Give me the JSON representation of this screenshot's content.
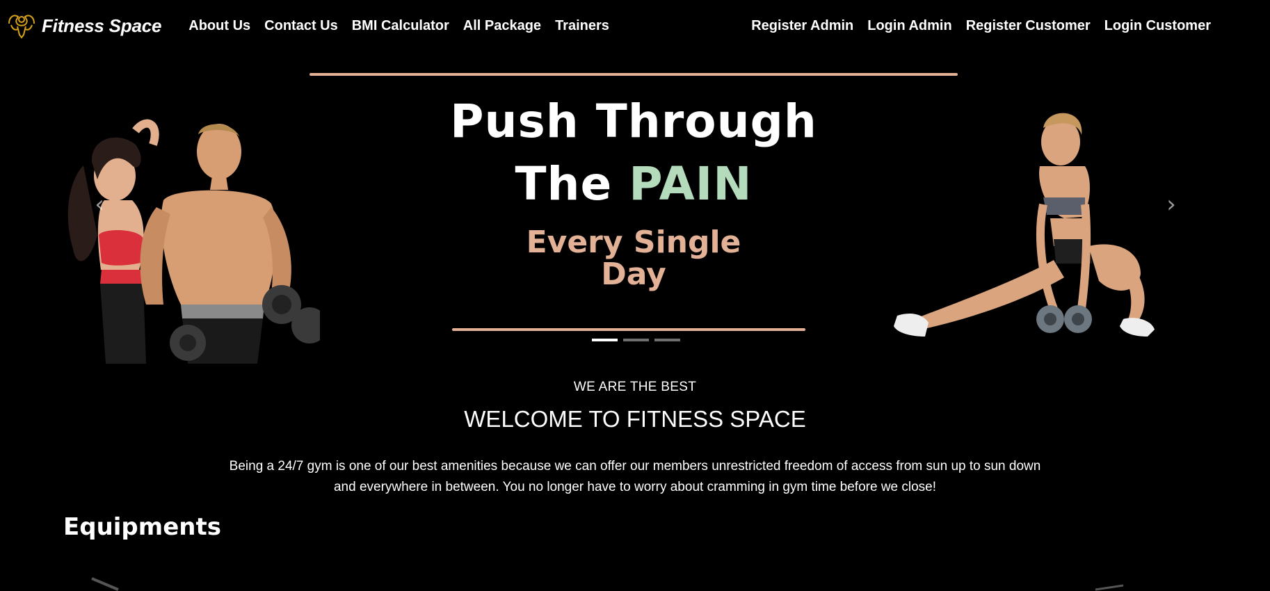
{
  "nav": {
    "brand": "Fitness Space",
    "left_links": [
      {
        "label": "About Us"
      },
      {
        "label": "Contact Us"
      },
      {
        "label": "BMI Calculator"
      },
      {
        "label": "All Package"
      },
      {
        "label": "Trainers"
      }
    ],
    "right_links": [
      {
        "label": "Register Admin"
      },
      {
        "label": "Login Admin"
      },
      {
        "label": "Register Customer"
      },
      {
        "label": "Login Customer"
      }
    ]
  },
  "hero": {
    "line1": "Push Through",
    "line2_a": "The",
    "line2_b": "PAIN",
    "sub_line1": "Every Single",
    "sub_line2": "Day",
    "active_slide": 1,
    "slide_count": 3,
    "colors": {
      "accent": "#e2b196",
      "pain": "#b4dcbc"
    }
  },
  "welcome": {
    "kicker": "WE ARE THE BEST",
    "title": "WELCOME TO FITNESS SPACE",
    "body": "Being a 24/7 gym is one of our best amenities because we can offer our members unrestricted freedom of access from sun up to sun down and everywhere in between. You no longer have to worry about cramming in gym time before we close!"
  },
  "equipments": {
    "heading": "Equipments"
  },
  "icons": {
    "brand": "muscle-logo-icon",
    "prev": "chevron-left-icon",
    "next": "chevron-right-icon"
  }
}
